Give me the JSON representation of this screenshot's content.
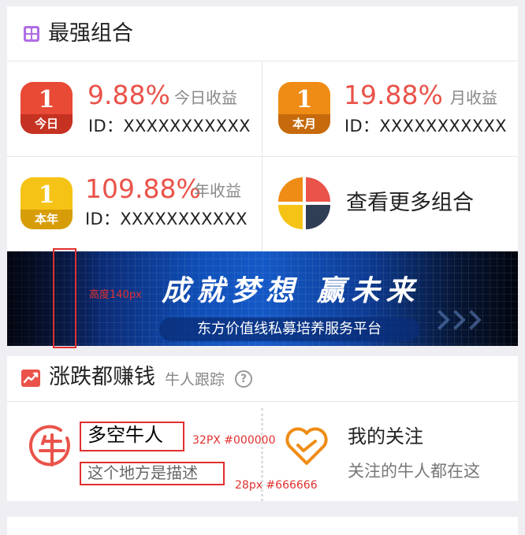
{
  "section1": {
    "title": "最强组合",
    "portfolios": [
      {
        "badge_num": "1",
        "badge_label": "今日",
        "percent": "9.88%",
        "label": "今日收益",
        "id": "ID：XXXXXXXXXXX"
      },
      {
        "badge_num": "1",
        "badge_label": "本月",
        "percent": "19.88%",
        "label": "月收益",
        "id": "ID：XXXXXXXXXXX"
      },
      {
        "badge_num": "1",
        "badge_label": "本年",
        "percent": "109.88%",
        "label": "年收益",
        "id": "ID：XXXXXXXXXXX"
      }
    ],
    "more_label": "查看更多组合"
  },
  "banner": {
    "slogan": "成就梦想 赢未来",
    "subtitle": "东方价值线私募培养服务平台"
  },
  "section2": {
    "title": "涨跌都赚钱",
    "subtitle": "牛人跟踪",
    "items": [
      {
        "title": "多空牛人",
        "desc": "这个地方是描述"
      },
      {
        "title": "我的关注",
        "desc": "关注的牛人都在这"
      }
    ]
  },
  "annotations": {
    "banner_height": "高度140px",
    "title_spec": "32PX  #000000",
    "desc_spec": "28px  #666666"
  },
  "colors": {
    "accent_red": "#e9534a",
    "badge_today": "#e94a35",
    "badge_month": "#ef8c15",
    "badge_year": "#f5c316",
    "annotation_red": "#e0302e",
    "title_text": "#000000",
    "desc_text": "#666666"
  }
}
